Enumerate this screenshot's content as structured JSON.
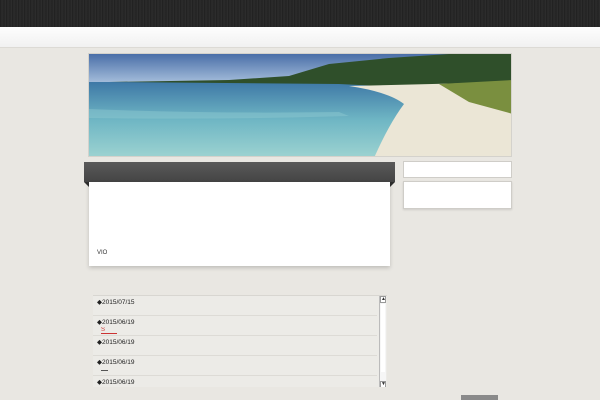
{
  "colors": {
    "page_background": "#e9e7e2",
    "top_bar": "#262626",
    "panel_header": "#4e4e4e",
    "link_red": "#cc3333"
  },
  "banner": {
    "image": "tropical beach photo: turquoise sea, white sand shore, tree line"
  },
  "main_panel": {
    "text": "VIO"
  },
  "news": {
    "items": [
      {
        "date": "◆2015/07/15",
        "link": ""
      },
      {
        "date": "◆2015/06/19",
        "link": "S"
      },
      {
        "date": "◆2015/06/19",
        "link": ""
      },
      {
        "date": "◆2015/06/19",
        "link": ""
      },
      {
        "date": "◆2015/06/19",
        "link": ""
      }
    ],
    "scroll_up": "▲",
    "scroll_down": "▼"
  },
  "footer": {
    "button_label": ""
  }
}
